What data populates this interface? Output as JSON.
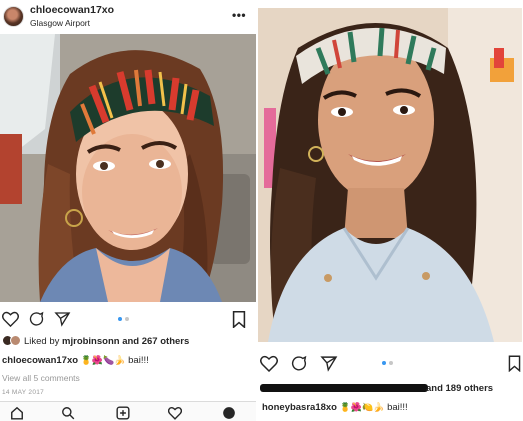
{
  "left_post": {
    "username": "chloecowan17xo",
    "location": "Glasgow Airport",
    "more_icon": "•••",
    "liked_prefix": "Liked by",
    "liked_by_user": "mjrobinsonn",
    "liked_suffix": "and 267 others",
    "caption_username": "chloecowan17xo",
    "caption_emoji": "🍍🌺🍆🍌",
    "caption_text": "bai!!!",
    "view_comments": "View all 5 comments",
    "date": "14 MAY 2017",
    "carousel": {
      "count": 2,
      "active_index": 0
    }
  },
  "right_post": {
    "likes_text": "and 189 others",
    "caption_username": "honeybasra18xo",
    "caption_emoji": "🍍🌺🍋🍌",
    "caption_text": "bai!!!",
    "carousel": {
      "count": 2,
      "active_index": 0
    }
  },
  "colors": {
    "text": "#262626",
    "secondary_text": "#999999",
    "active_dot": "#3897f0",
    "inactive_dot": "#c7c7c7",
    "nav_bg": "#fafafa"
  },
  "icons": {
    "like": "heart-icon",
    "comment": "comment-icon",
    "share": "send-icon",
    "save": "bookmark-icon",
    "home": "home-icon",
    "search": "search-icon",
    "new_post": "add-post-icon",
    "activity": "heart-icon",
    "profile": "profile-icon"
  }
}
